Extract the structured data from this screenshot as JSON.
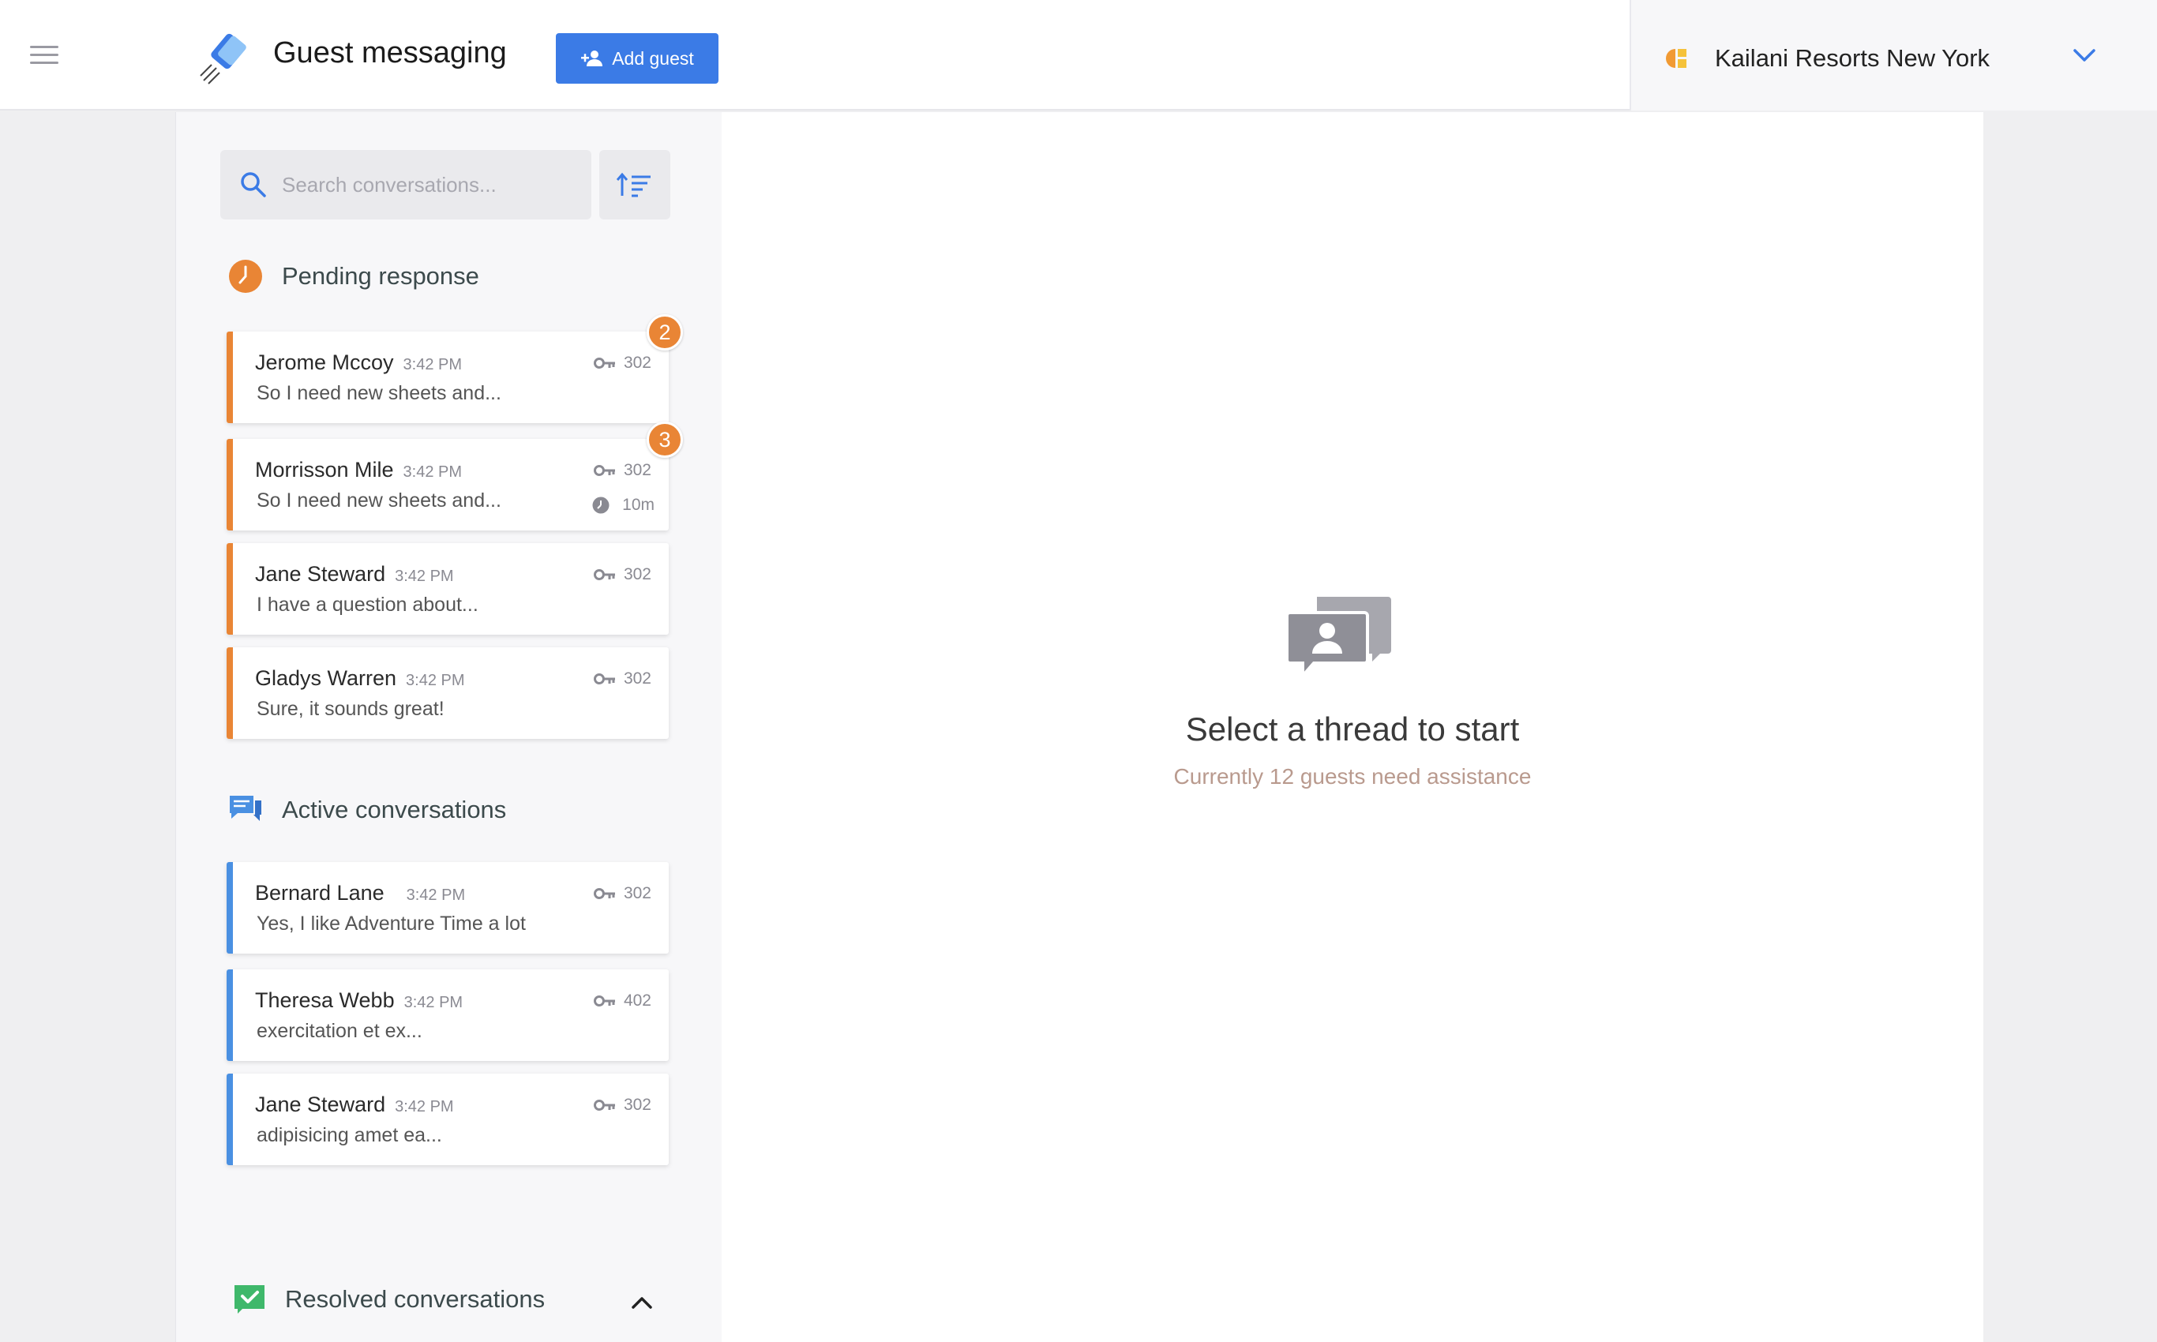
{
  "app": {
    "title": "Guest messaging",
    "add_guest_label": "Add guest"
  },
  "property": {
    "name": "Kailani Resorts New York"
  },
  "search": {
    "placeholder": "Search conversations..."
  },
  "colors": {
    "accent": "#3b7be6",
    "pending": "#e98535",
    "active": "#4a90e2",
    "resolved": "#3fb86b"
  },
  "sections": {
    "pending": {
      "title": "Pending response",
      "icon": "clock-icon",
      "items": [
        {
          "name": "Jerome Mccoy",
          "time": "3:42 PM",
          "message": "So I need new sheets and...",
          "room": "302",
          "badge": "2"
        },
        {
          "name": "Morrisson Mile",
          "time": "3:42 PM",
          "message": "So I need new sheets and...",
          "room": "302",
          "badge": "3",
          "wait": "10m"
        },
        {
          "name": "Jane Steward",
          "time": "3:42 PM",
          "message": "I have a question about...",
          "room": "302"
        },
        {
          "name": "Gladys Warren",
          "time": "3:42 PM",
          "message": "Sure, it sounds great!",
          "room": "302"
        }
      ]
    },
    "active": {
      "title": "Active conversations",
      "icon": "chat-icon",
      "items": [
        {
          "name": "Bernard Lane",
          "time": "3:42 PM",
          "message": "Yes, I like Adventure Time a lot",
          "room": "302"
        },
        {
          "name": "Theresa Webb",
          "time": "3:42 PM",
          "message": "exercitation et ex...",
          "room": "402"
        },
        {
          "name": "Jane Steward",
          "time": "3:42 PM",
          "message": "adipisicing amet ea...",
          "room": "302"
        }
      ]
    },
    "resolved": {
      "title": "Resolved conversations",
      "icon": "check-icon"
    }
  },
  "empty_state": {
    "title": "Select a thread to start",
    "subtitle": "Currently 12 guests need assistance"
  }
}
